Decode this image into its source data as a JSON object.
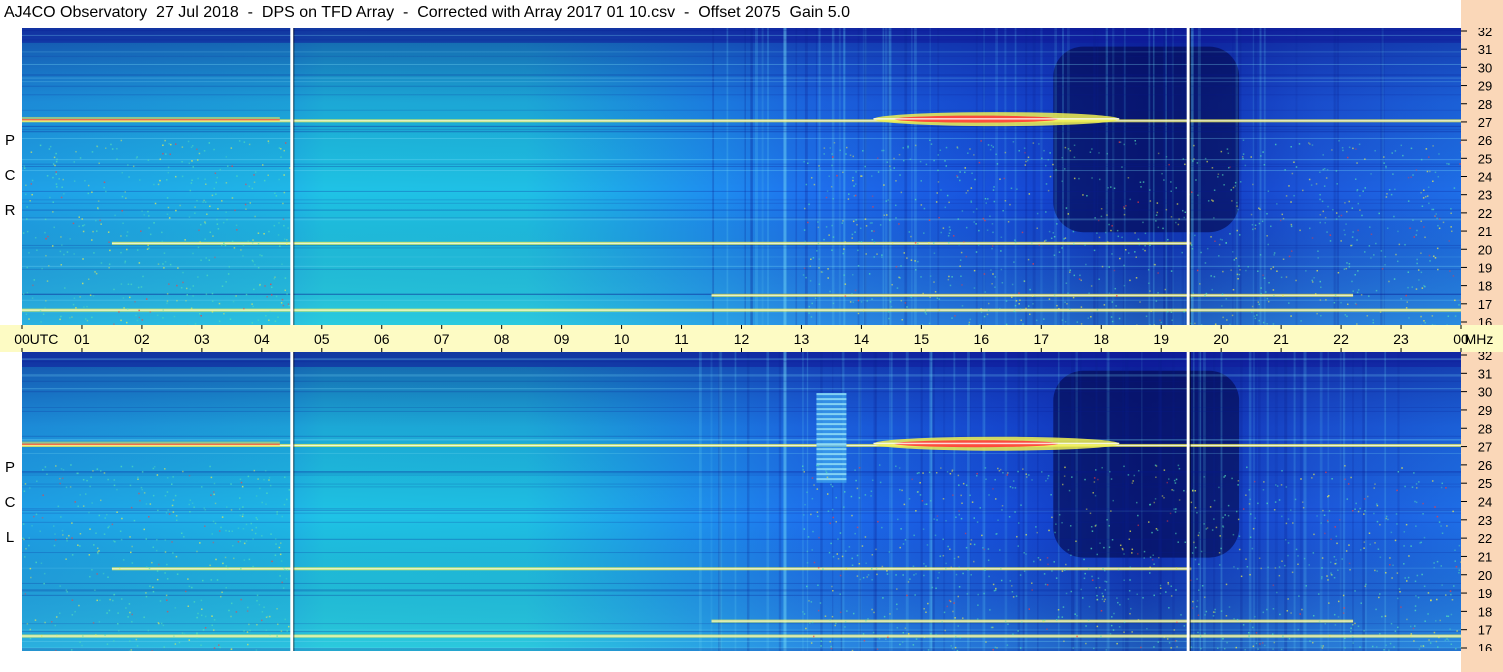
{
  "title": "AJ4CO Observatory  27 Jul 2018  -  DPS on TFD Array  -  Corrected with Array 2017 01 10.csv  -  Offset 2075  Gain 5.0",
  "chart_data": {
    "type": "heatmap",
    "title": "AJ4CO Observatory  27 Jul 2018  -  DPS on TFD Array  -  Corrected with Array 2017 01 10.csv  -  Offset 2075  Gain 5.0",
    "x_axis": {
      "ticks": [
        "00",
        "UTC",
        "01",
        "02",
        "03",
        "04",
        "05",
        "06",
        "07",
        "08",
        "09",
        "10",
        "11",
        "12",
        "13",
        "14",
        "15",
        "16",
        "17",
        "18",
        "19",
        "20",
        "21",
        "22",
        "23",
        "00",
        "MHz"
      ],
      "range_hours": [
        0,
        24
      ]
    },
    "y_axis": {
      "unit": "MHz",
      "range": [
        16,
        32
      ],
      "ticks": [
        32,
        31,
        30,
        29,
        28,
        27,
        26,
        25,
        24,
        23,
        22,
        21,
        20,
        19,
        18,
        17,
        16
      ]
    },
    "panels": [
      {
        "label": [
          "R",
          "C",
          "P"
        ]
      },
      {
        "label": [
          "L",
          "C",
          "P"
        ]
      }
    ],
    "markers_utc": [
      4.5,
      19.45
    ],
    "colormap": [
      "#0a0f8a",
      "#1437d6",
      "#1e7ef0",
      "#1fc3e6",
      "#54e0b8",
      "#f0f050",
      "#ff3a3a",
      "#ffffff"
    ],
    "features": [
      {
        "name": "broadband band",
        "freq_mhz": 27,
        "utc": [
          0,
          24
        ]
      },
      {
        "name": "intense emission",
        "freq_mhz": 27.2,
        "utc": [
          14.2,
          18.3
        ]
      },
      {
        "name": "band",
        "freq_mhz": 17.6,
        "utc": [
          11.5,
          22.2
        ]
      },
      {
        "name": "band",
        "freq_mhz": 16.8,
        "utc": [
          0,
          24
        ]
      },
      {
        "name": "band",
        "freq_mhz": 20.4,
        "utc": [
          1.5,
          19.5
        ]
      },
      {
        "name": "striped burst",
        "freq_mhz": [
          25,
          29.8
        ],
        "utc": [
          13.25,
          13.75
        ],
        "panel": 1
      }
    ]
  }
}
